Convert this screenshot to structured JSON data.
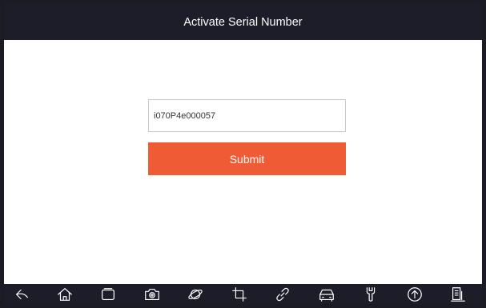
{
  "header": {
    "title": "Activate Serial Number"
  },
  "form": {
    "serial_value": "i070P4e000057",
    "submit_label": "Submit"
  },
  "colors": {
    "title_bar": "#1d1d29",
    "submit_button": "#ef5b35",
    "background": "#ffffff"
  },
  "navbar": {
    "icons": [
      "back-icon",
      "home-icon",
      "recent-apps-icon",
      "camera-icon",
      "browser-icon",
      "crop-icon",
      "link-icon",
      "car-icon",
      "wrench-icon",
      "upload-icon",
      "report-icon"
    ]
  }
}
